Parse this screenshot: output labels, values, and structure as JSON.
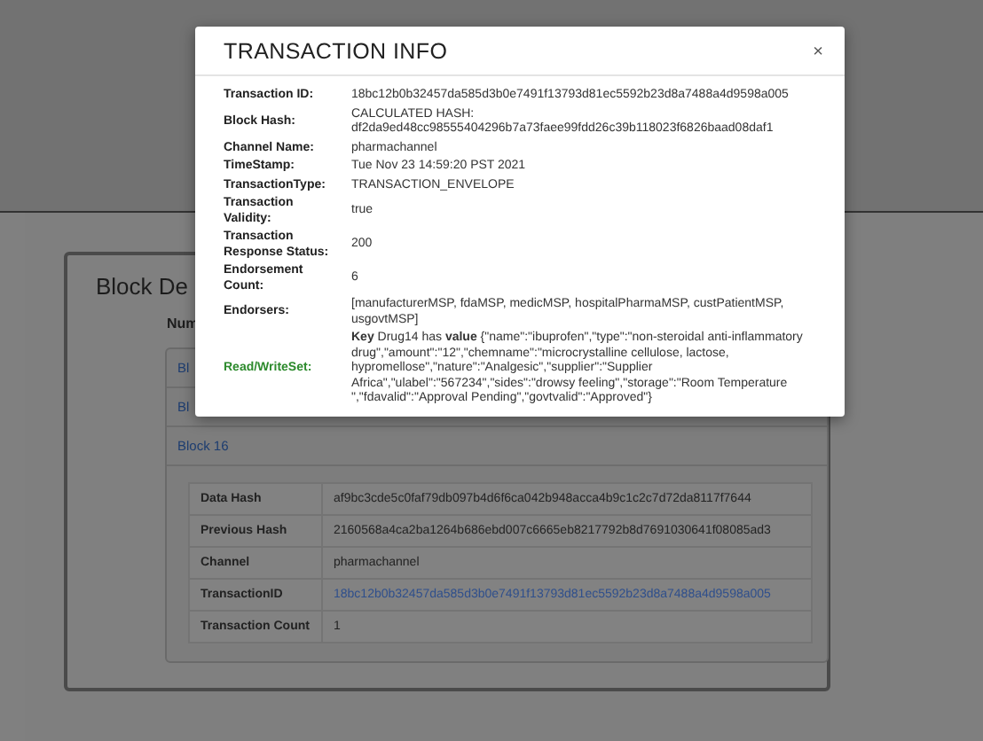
{
  "page": {
    "heading": "Block De",
    "number_label": "Num",
    "blocks": [
      {
        "label": "Bl"
      },
      {
        "label": "Bl"
      },
      {
        "label": "Block 16"
      }
    ],
    "details": [
      {
        "label": "Data Hash",
        "value": "af9bc3cde5c0faf79db097b4d6f6ca042b948acca4b9c1c2c7d72da8117f7644",
        "kind": "text"
      },
      {
        "label": "Previous Hash",
        "value": "2160568a4ca2ba1264b686ebd007c6665eb8217792b8d7691030641f08085ad3",
        "kind": "text"
      },
      {
        "label": "Channel",
        "value": "pharmachannel",
        "kind": "text"
      },
      {
        "label": "TransactionID",
        "value": "18bc12b0b32457da585d3b0e7491f13793d81ec5592b23d8a7488a4d9598a005",
        "kind": "link"
      },
      {
        "label": "Transaction Count",
        "value": "1",
        "kind": "text"
      }
    ]
  },
  "modal": {
    "title": "TRANSACTION INFO",
    "close": "×",
    "fields": [
      {
        "label": "Transaction ID:",
        "value": "18bc12b0b32457da585d3b0e7491f13793d81ec5592b23d8a7488a4d9598a005",
        "kind": "plain"
      },
      {
        "label": "Block Hash:",
        "value": "CALCULATED HASH: df2da9ed48cc98555404296b7a73faee99fdd26c39b118023f6826baad08daf1",
        "kind": "plain"
      },
      {
        "label": "Channel Name:",
        "value": "pharmachannel",
        "kind": "plain"
      },
      {
        "label": "TimeStamp:",
        "value": "Tue Nov 23 14:59:20 PST 2021",
        "kind": "plain"
      },
      {
        "label": "TransactionType:",
        "value": "TRANSACTION_ENVELOPE",
        "kind": "plain"
      },
      {
        "label": "Transaction Validity:",
        "value": "true",
        "kind": "plain"
      },
      {
        "label": "Transaction Response Status:",
        "value": "200",
        "kind": "plain"
      },
      {
        "label": "Endorsement Count:",
        "value": "6",
        "kind": "plain"
      },
      {
        "label": "Endorsers:",
        "value": "[manufacturerMSP, fdaMSP, medicMSP, hospitalPharmaMSP, custPatientMSP, usgovtMSP]",
        "kind": "plain"
      },
      {
        "label": "Read/WriteSet:",
        "value": "**Key** Drug14 has **value** {\"name\":\"ibuprofen\",\"type\":\"non-steroidal anti-inflammatory drug\",\"amount\":\"12\",\"chemname\":\"microcrystalline cellulose, lactose, hypromellose\",\"nature\":\"Analgesic\",\"supplier\":\"Supplier Africa\",\"ulabel\":\"567234\",\"sides\":\"drowsy feeling\",\"storage\":\"Room Temperature \",\"fdavalid\":\"Approval Pending\",\"govtvalid\":\"Approved\"}",
        "kind": "readwrite"
      }
    ]
  }
}
